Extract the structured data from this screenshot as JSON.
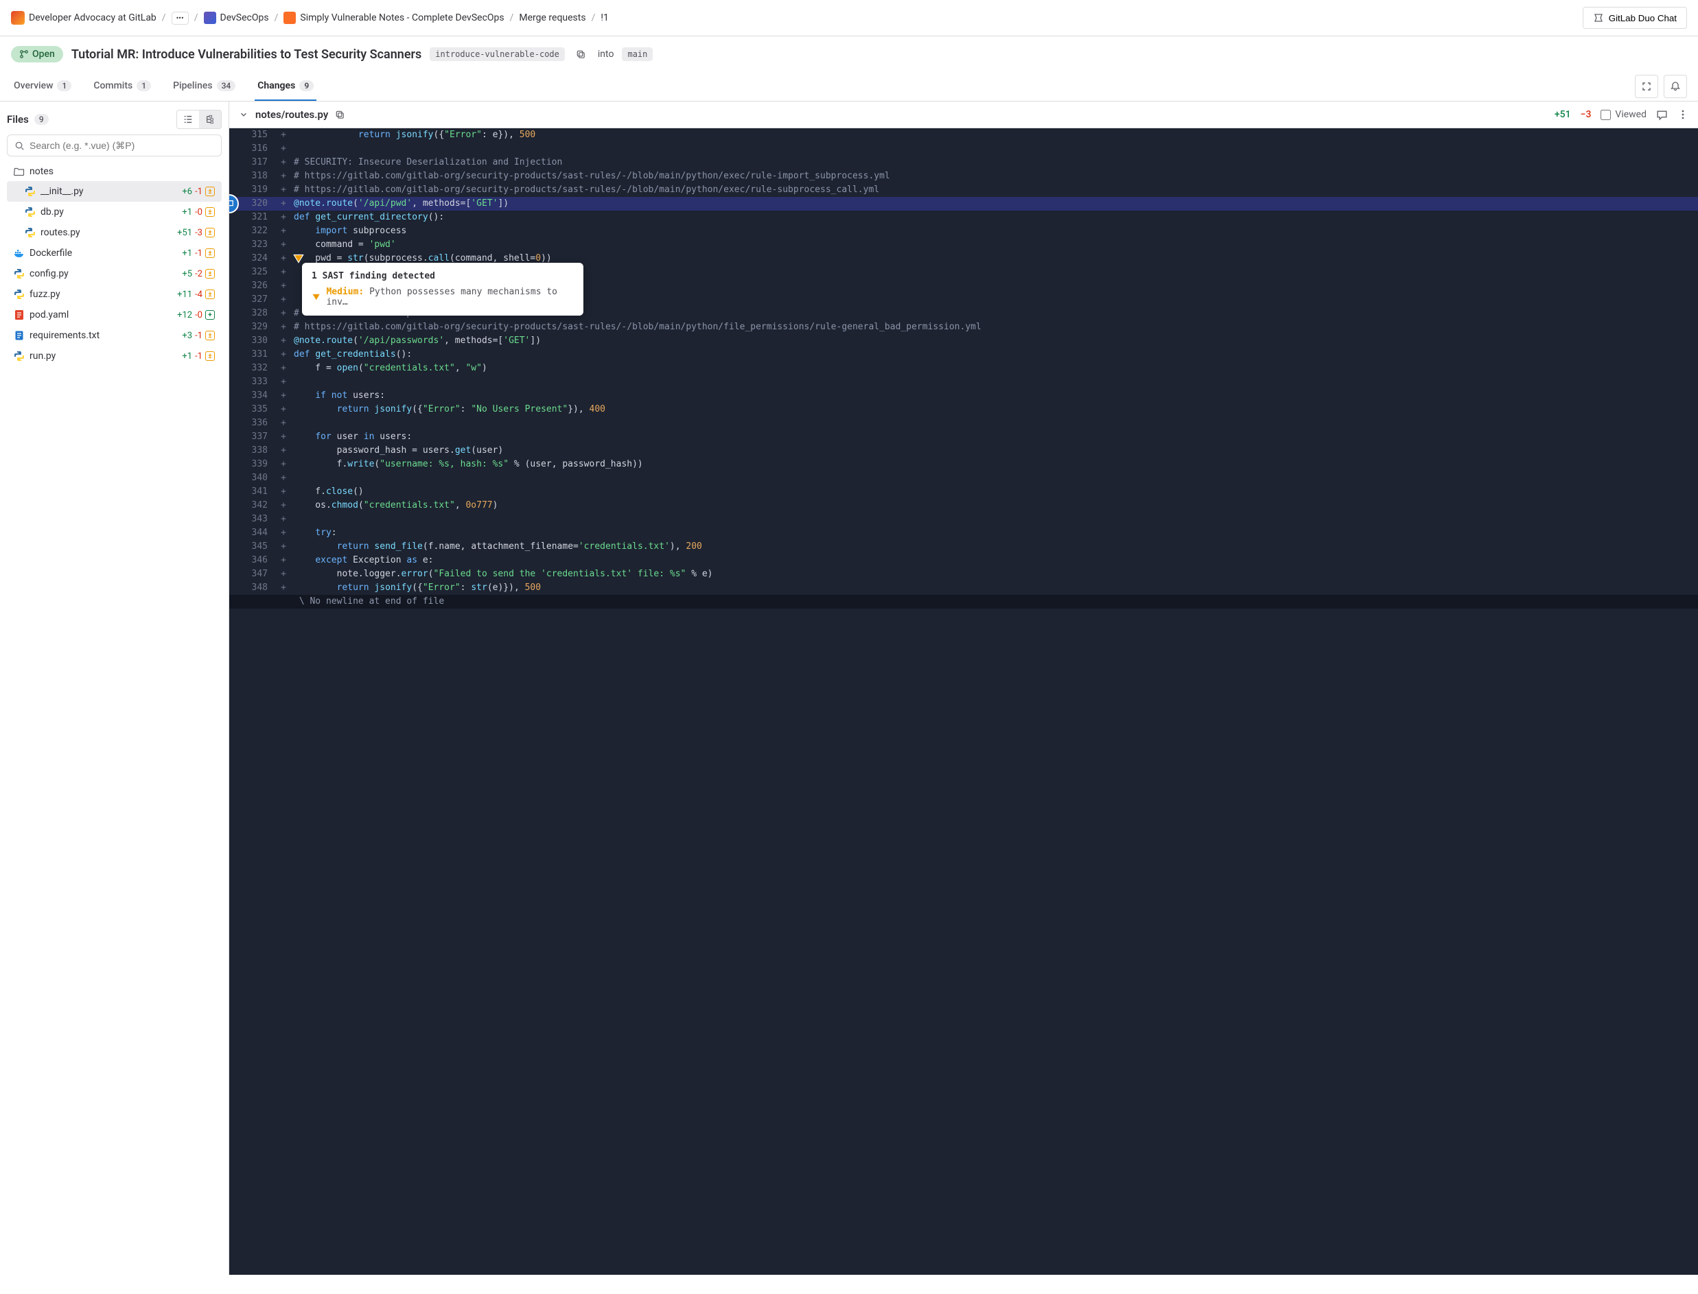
{
  "breadcrumb": {
    "group": "Developer Advocacy at GitLab",
    "subgroup": "DevSecOps",
    "project": "Simply Vulnerable Notes - Complete DevSecOps",
    "section": "Merge requests",
    "mr_iid": "!1"
  },
  "duo_button": "GitLab Duo Chat",
  "mr": {
    "status": "Open",
    "title": "Tutorial MR: Introduce Vulnerabilities to Test Security Scanners",
    "source_branch": "introduce-vulnerable-code",
    "into_word": "into",
    "target_branch": "main"
  },
  "tabs": {
    "overview": {
      "label": "Overview",
      "count": "1"
    },
    "commits": {
      "label": "Commits",
      "count": "1"
    },
    "pipelines": {
      "label": "Pipelines",
      "count": "34"
    },
    "changes": {
      "label": "Changes",
      "count": "9"
    }
  },
  "sidebar": {
    "files_label": "Files",
    "files_count": "9",
    "search_placeholder": "Search (e.g. *.vue) (⌘P)",
    "folder": "notes",
    "files": [
      {
        "name": "__init__.py",
        "add": "+6",
        "rem": "-1",
        "type": "mod",
        "icon": "py",
        "indent": true,
        "sel": true
      },
      {
        "name": "db.py",
        "add": "+1",
        "rem": "-0",
        "type": "mod",
        "icon": "py",
        "indent": true
      },
      {
        "name": "routes.py",
        "add": "+51",
        "rem": "-3",
        "type": "mod",
        "icon": "py",
        "indent": true
      },
      {
        "name": "Dockerfile",
        "add": "+1",
        "rem": "-1",
        "type": "mod",
        "icon": "docker"
      },
      {
        "name": "config.py",
        "add": "+5",
        "rem": "-2",
        "type": "mod",
        "icon": "py"
      },
      {
        "name": "fuzz.py",
        "add": "+11",
        "rem": "-4",
        "type": "mod",
        "icon": "py"
      },
      {
        "name": "pod.yaml",
        "add": "+12",
        "rem": "-0",
        "type": "add",
        "icon": "yaml"
      },
      {
        "name": "requirements.txt",
        "add": "+3",
        "rem": "-1",
        "type": "mod",
        "icon": "txt"
      },
      {
        "name": "run.py",
        "add": "+1",
        "rem": "-1",
        "type": "mod",
        "icon": "py"
      }
    ]
  },
  "diff": {
    "file_path": "notes/routes.py",
    "added": "+51",
    "removed": "−3",
    "viewed_label": "Viewed",
    "no_newline": "\\ No newline at end of file"
  },
  "sast": {
    "title": "1 SAST finding detected",
    "severity": "Medium:",
    "message": "Python possesses many mechanisms to inv…"
  },
  "code_lines": [
    {
      "n": "315",
      "g": "+",
      "seg": [
        [
          "",
          "            "
        ],
        [
          "kw",
          "return"
        ],
        [
          "",
          " "
        ],
        [
          "fn",
          "jsonify"
        ],
        [
          "",
          "({"
        ],
        [
          "str",
          "\"Error\""
        ],
        [
          "",
          ": e}), "
        ],
        [
          "num",
          "500"
        ]
      ]
    },
    {
      "n": "316",
      "g": "+",
      "seg": [
        [
          "",
          ""
        ]
      ]
    },
    {
      "n": "317",
      "g": "+",
      "seg": [
        [
          "cmt",
          "# SECURITY: Insecure Deserialization and Injection"
        ]
      ]
    },
    {
      "n": "318",
      "g": "+",
      "seg": [
        [
          "cmt",
          "# https://gitlab.com/gitlab-org/security-products/sast-rules/-/blob/main/python/exec/rule-import_subprocess.yml"
        ]
      ]
    },
    {
      "n": "319",
      "g": "+",
      "seg": [
        [
          "cmt",
          "# https://gitlab.com/gitlab-org/security-products/sast-rules/-/blob/main/python/exec/rule-subprocess_call.yml"
        ]
      ]
    },
    {
      "n": "320",
      "g": "+",
      "hl": true,
      "thread": true,
      "seg": [
        [
          "fn",
          "@note.route"
        ],
        [
          "",
          "("
        ],
        [
          "str",
          "'/api/pwd'"
        ],
        [
          "",
          ", methods=["
        ],
        [
          "str",
          "'GET'"
        ],
        [
          "",
          "])"
        ]
      ]
    },
    {
      "n": "321",
      "g": "+",
      "seg": [
        [
          "kw",
          "def"
        ],
        [
          "",
          " "
        ],
        [
          "fn",
          "get_current_directory"
        ],
        [
          "",
          "():"
        ]
      ]
    },
    {
      "n": "322",
      "g": "+",
      "seg": [
        [
          "",
          "    "
        ],
        [
          "kw",
          "import"
        ],
        [
          "",
          " subprocess"
        ]
      ]
    },
    {
      "n": "323",
      "g": "+",
      "seg": [
        [
          "",
          "    command = "
        ],
        [
          "str",
          "'pwd'"
        ]
      ]
    },
    {
      "n": "324",
      "g": "+",
      "sast": true,
      "seg": [
        [
          "",
          "    pwd = "
        ],
        [
          "fn",
          "str"
        ],
        [
          "",
          "(subprocess."
        ],
        [
          "fn",
          "call"
        ],
        [
          "",
          "(command, shell="
        ],
        [
          "num",
          "0"
        ],
        [
          "",
          "))"
        ]
      ]
    },
    {
      "n": "325",
      "g": "+",
      "seg": [
        [
          "",
          ""
        ]
      ]
    },
    {
      "n": "326",
      "g": "+",
      "seg": [
        [
          "",
          ""
        ]
      ]
    },
    {
      "n": "327",
      "g": "+",
      "seg": [
        [
          "",
          ""
        ]
      ]
    },
    {
      "n": "328",
      "g": "+",
      "seg": [
        [
          "cmt",
          "# SECURITY: Bad file permissions"
        ]
      ]
    },
    {
      "n": "329",
      "g": "+",
      "seg": [
        [
          "cmt",
          "# https://gitlab.com/gitlab-org/security-products/sast-rules/-/blob/main/python/file_permissions/rule-general_bad_permission.yml"
        ]
      ]
    },
    {
      "n": "330",
      "g": "+",
      "seg": [
        [
          "fn",
          "@note.route"
        ],
        [
          "",
          "("
        ],
        [
          "str",
          "'/api/passwords'"
        ],
        [
          "",
          ", methods=["
        ],
        [
          "str",
          "'GET'"
        ],
        [
          "",
          "])"
        ]
      ]
    },
    {
      "n": "331",
      "g": "+",
      "seg": [
        [
          "kw",
          "def"
        ],
        [
          "",
          " "
        ],
        [
          "fn",
          "get_credentials"
        ],
        [
          "",
          "():"
        ]
      ]
    },
    {
      "n": "332",
      "g": "+",
      "seg": [
        [
          "",
          "    f = "
        ],
        [
          "fn",
          "open"
        ],
        [
          "",
          "("
        ],
        [
          "str",
          "\"credentials.txt\""
        ],
        [
          "",
          ", "
        ],
        [
          "str",
          "\"w\""
        ],
        [
          "",
          ")"
        ]
      ]
    },
    {
      "n": "333",
      "g": "+",
      "seg": [
        [
          "",
          ""
        ]
      ]
    },
    {
      "n": "334",
      "g": "+",
      "seg": [
        [
          "",
          "    "
        ],
        [
          "kw",
          "if"
        ],
        [
          "",
          " "
        ],
        [
          "kw",
          "not"
        ],
        [
          "",
          " users:"
        ]
      ]
    },
    {
      "n": "335",
      "g": "+",
      "seg": [
        [
          "",
          "        "
        ],
        [
          "kw",
          "return"
        ],
        [
          "",
          " "
        ],
        [
          "fn",
          "jsonify"
        ],
        [
          "",
          "({"
        ],
        [
          "str",
          "\"Error\""
        ],
        [
          "",
          ": "
        ],
        [
          "str",
          "\"No Users Present\""
        ],
        [
          "",
          "}), "
        ],
        [
          "num",
          "400"
        ]
      ]
    },
    {
      "n": "336",
      "g": "+",
      "seg": [
        [
          "",
          ""
        ]
      ]
    },
    {
      "n": "337",
      "g": "+",
      "seg": [
        [
          "",
          "    "
        ],
        [
          "kw",
          "for"
        ],
        [
          "",
          " user "
        ],
        [
          "kw",
          "in"
        ],
        [
          "",
          " users:"
        ]
      ]
    },
    {
      "n": "338",
      "g": "+",
      "seg": [
        [
          "",
          "        password_hash = users."
        ],
        [
          "fn",
          "get"
        ],
        [
          "",
          "(user)"
        ]
      ]
    },
    {
      "n": "339",
      "g": "+",
      "seg": [
        [
          "",
          "        f."
        ],
        [
          "fn",
          "write"
        ],
        [
          "",
          "("
        ],
        [
          "str",
          "\"username: %s, hash: %s\""
        ],
        [
          "",
          " % (user, password_hash))"
        ]
      ]
    },
    {
      "n": "340",
      "g": "+",
      "seg": [
        [
          "",
          ""
        ]
      ]
    },
    {
      "n": "341",
      "g": "+",
      "seg": [
        [
          "",
          "    f."
        ],
        [
          "fn",
          "close"
        ],
        [
          "",
          "()"
        ]
      ]
    },
    {
      "n": "342",
      "g": "+",
      "seg": [
        [
          "",
          "    os."
        ],
        [
          "fn",
          "chmod"
        ],
        [
          "",
          "("
        ],
        [
          "str",
          "\"credentials.txt\""
        ],
        [
          "",
          ", "
        ],
        [
          "num",
          "0o777"
        ],
        [
          "",
          ")"
        ]
      ]
    },
    {
      "n": "343",
      "g": "+",
      "seg": [
        [
          "",
          ""
        ]
      ]
    },
    {
      "n": "344",
      "g": "+",
      "seg": [
        [
          "",
          "    "
        ],
        [
          "kw",
          "try"
        ],
        [
          "",
          ":"
        ]
      ]
    },
    {
      "n": "345",
      "g": "+",
      "seg": [
        [
          "",
          "        "
        ],
        [
          "kw",
          "return"
        ],
        [
          "",
          " "
        ],
        [
          "fn",
          "send_file"
        ],
        [
          "",
          "(f.name, attachment_filename="
        ],
        [
          "str",
          "'credentials.txt'"
        ],
        [
          "",
          "), "
        ],
        [
          "num",
          "200"
        ]
      ]
    },
    {
      "n": "346",
      "g": "+",
      "seg": [
        [
          "",
          "    "
        ],
        [
          "kw",
          "except"
        ],
        [
          "",
          " Exception "
        ],
        [
          "kw",
          "as"
        ],
        [
          "",
          " e:"
        ]
      ]
    },
    {
      "n": "347",
      "g": "+",
      "seg": [
        [
          "",
          "        note.logger."
        ],
        [
          "fn",
          "error"
        ],
        [
          "",
          "("
        ],
        [
          "str",
          "\"Failed to send the 'credentials.txt' file: %s\""
        ],
        [
          "",
          " % e)"
        ]
      ]
    },
    {
      "n": "348",
      "g": "+",
      "seg": [
        [
          "",
          "        "
        ],
        [
          "kw",
          "return"
        ],
        [
          "",
          " "
        ],
        [
          "fn",
          "jsonify"
        ],
        [
          "",
          "({"
        ],
        [
          "str",
          "\"Error\""
        ],
        [
          "",
          ": "
        ],
        [
          "fn",
          "str"
        ],
        [
          "",
          "(e)}), "
        ],
        [
          "num",
          "500"
        ]
      ]
    }
  ]
}
